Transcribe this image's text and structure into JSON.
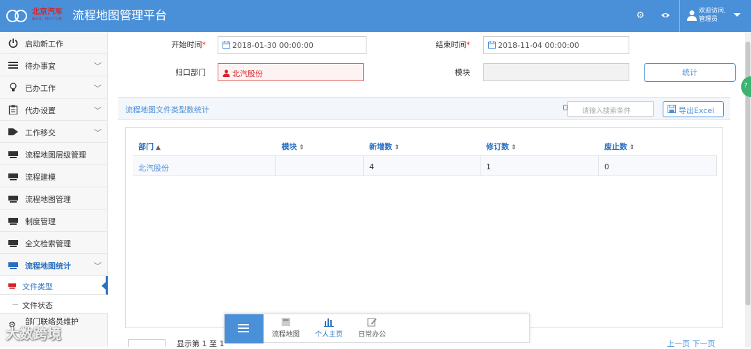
{
  "header": {
    "brand_cn": "北京汽车",
    "brand_en": "BAIC MOTOR",
    "title": "流程地图管理平台",
    "welcome_line1": "欢迎访问,",
    "welcome_line2": "管理员",
    "icons": [
      "gears-icon",
      "eye-icon",
      "user-icon"
    ]
  },
  "sidebar": {
    "items": [
      {
        "label": "启动新工作",
        "icon": "power-icon",
        "chevron": false
      },
      {
        "label": "待办事宜",
        "icon": "list-icon",
        "chevron": true
      },
      {
        "label": "已办工作",
        "icon": "bulb-icon",
        "chevron": true
      },
      {
        "label": "代办设置",
        "icon": "clipboard-icon",
        "chevron": true
      },
      {
        "label": "工作移交",
        "icon": "tag-icon",
        "chevron": true
      },
      {
        "label": "流程地图层级管理",
        "icon": "board-icon",
        "chevron": false
      },
      {
        "label": "流程建模",
        "icon": "board-icon",
        "chevron": false
      },
      {
        "label": "流程地图管理",
        "icon": "board-icon",
        "chevron": false
      },
      {
        "label": "制度管理",
        "icon": "board-icon",
        "chevron": false
      },
      {
        "label": "全文检索管理",
        "icon": "board-icon",
        "chevron": false
      },
      {
        "label": "流程地图统计",
        "icon": "board-icon",
        "chevron": true,
        "active": true
      }
    ],
    "subitems": [
      {
        "label": "文件类型",
        "active": true
      },
      {
        "label": "文件状态",
        "active": false
      }
    ],
    "last_item": {
      "label": "部门联络员维护",
      "icon": "gear-icon"
    }
  },
  "filters": {
    "start_label": "开始时间",
    "start_value": "2018-01-30 00:00:00",
    "end_label": "结束时间",
    "end_value": "2018-11-04 00:00:00",
    "dept_label": "归口部门",
    "dept_value": "北汽股份",
    "module_label": "模块",
    "module_value": "",
    "required_mark": "*",
    "stat_button": "统计"
  },
  "section": {
    "title": "流程地图文件类型数统计",
    "search_placeholder": "请输入搜索条件",
    "export_button": "导出Excel"
  },
  "table": {
    "columns": [
      {
        "label": "部门",
        "sort": "▲"
      },
      {
        "label": "模块",
        "sort": "⇕"
      },
      {
        "label": "新增数",
        "sort": "⇕"
      },
      {
        "label": "修订数",
        "sort": "⇕"
      },
      {
        "label": "废止数",
        "sort": "⇕"
      }
    ],
    "rows": [
      [
        "北汽股份",
        "",
        "4",
        "1",
        "0"
      ]
    ]
  },
  "pagination": {
    "info": "显示第 1 至 1",
    "nav": "上一页 下一页"
  },
  "dock": {
    "items": [
      {
        "label": "流程地图",
        "icon": "map-icon",
        "active": false
      },
      {
        "label": "个人主页",
        "icon": "chart-icon",
        "active": true
      },
      {
        "label": "日常办公",
        "icon": "edit-icon",
        "active": false
      }
    ]
  },
  "side_tab": "?",
  "watermark": "大数跨境",
  "colors": {
    "header_bg": "#4a90d9",
    "accent": "#2a6fc0",
    "brand_red": "#d7232b",
    "error_border": "#e06060",
    "side_tab": "#3cb371"
  }
}
